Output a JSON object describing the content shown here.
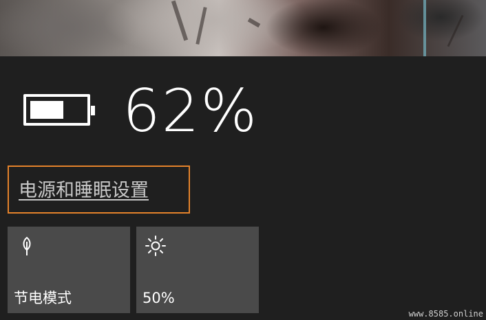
{
  "battery": {
    "percent_text": "62%",
    "level": 0.62,
    "icon": "battery-icon"
  },
  "power_settings_link": {
    "label": "电源和睡眠设置",
    "focus_color": "#e5832b"
  },
  "quick_actions": [
    {
      "label": "节电模式",
      "icon": "leaf-icon"
    },
    {
      "label": "50%",
      "icon": "brightness-sun-icon"
    }
  ],
  "watermark": "www.8585.online",
  "colors": {
    "flyout_background": "#1f1f1f",
    "tile_background": "#4a4a4a",
    "text": "#ffffff",
    "link_text": "#c8c8c8"
  }
}
